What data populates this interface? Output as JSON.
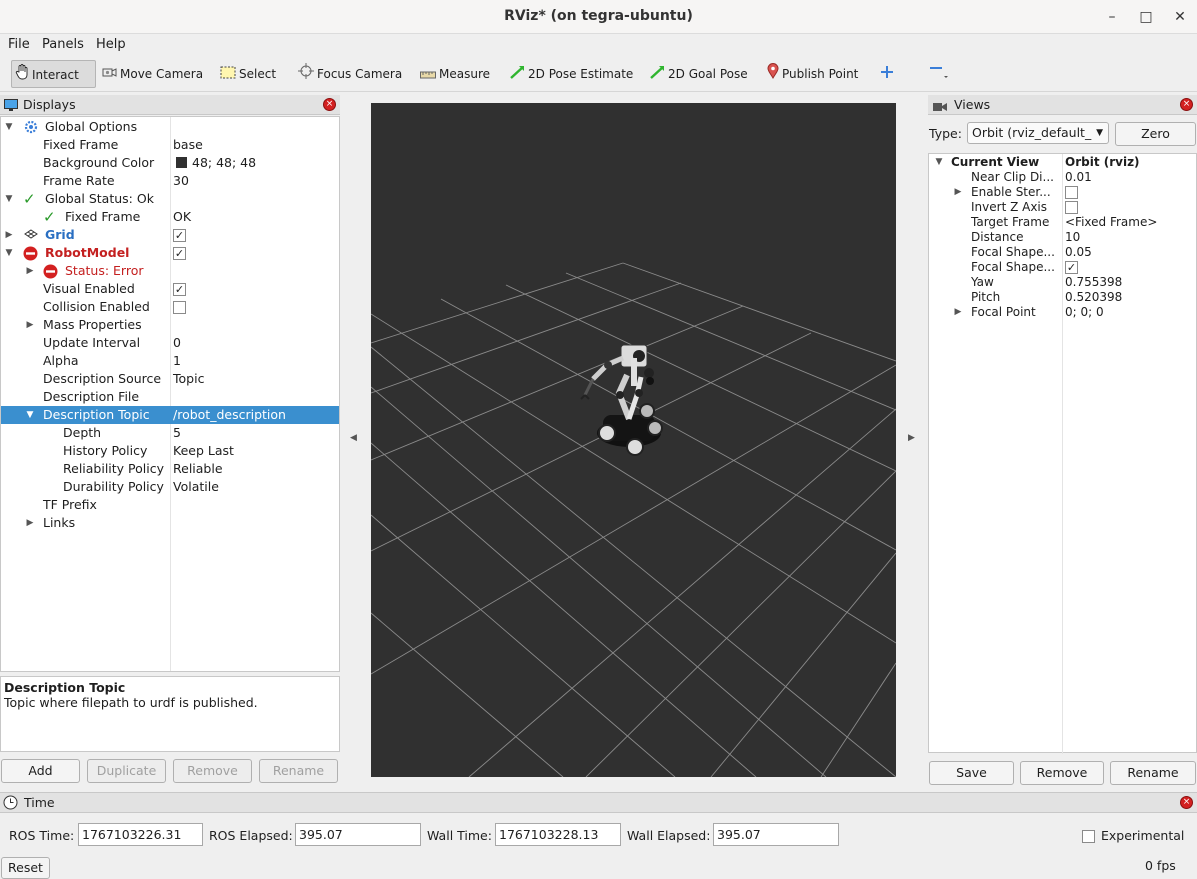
{
  "window": {
    "title": "RViz* (on tegra-ubuntu)",
    "minimize": "–",
    "maximize": "□",
    "close": "✕"
  },
  "menu": [
    "File",
    "Panels",
    "Help"
  ],
  "toolbar": {
    "interact": "Interact",
    "move_camera": "Move Camera",
    "select": "Select",
    "focus_camera": "Focus Camera",
    "measure": "Measure",
    "pose_estimate": "2D Pose Estimate",
    "goal_pose": "2D Goal Pose",
    "publish_point": "Publish Point"
  },
  "displays": {
    "title": "Displays",
    "rows": [
      {
        "label": "Global Options",
        "value": ""
      },
      {
        "label": "Fixed Frame",
        "value": "base"
      },
      {
        "label": "Background Color",
        "value": "48; 48; 48"
      },
      {
        "label": "Frame Rate",
        "value": "30"
      },
      {
        "label": "Global Status: Ok",
        "value": ""
      },
      {
        "label": "Fixed Frame",
        "value": "OK"
      },
      {
        "label": "Grid",
        "value": ""
      },
      {
        "label": "RobotModel",
        "value": ""
      },
      {
        "label": "Status: Error",
        "value": ""
      },
      {
        "label": "Visual Enabled",
        "value": ""
      },
      {
        "label": "Collision Enabled",
        "value": ""
      },
      {
        "label": "Mass Properties",
        "value": ""
      },
      {
        "label": "Update Interval",
        "value": "0"
      },
      {
        "label": "Alpha",
        "value": "1"
      },
      {
        "label": "Description Source",
        "value": "Topic"
      },
      {
        "label": "Description File",
        "value": ""
      },
      {
        "label": "Description Topic",
        "value": "/robot_description"
      },
      {
        "label": "Depth",
        "value": "5"
      },
      {
        "label": "History Policy",
        "value": "Keep Last"
      },
      {
        "label": "Reliability Policy",
        "value": "Reliable"
      },
      {
        "label": "Durability Policy",
        "value": "Volatile"
      },
      {
        "label": "TF Prefix",
        "value": ""
      },
      {
        "label": "Links",
        "value": ""
      }
    ],
    "description_title": "Description Topic",
    "description_text": "Topic where filepath to urdf is published.",
    "buttons": {
      "add": "Add",
      "duplicate": "Duplicate",
      "remove": "Remove",
      "rename": "Rename"
    },
    "background_color": "#303030"
  },
  "views": {
    "title": "Views",
    "type_label": "Type:",
    "type_value": "Orbit (rviz_default_",
    "zero": "Zero",
    "rows": [
      {
        "label": "Current View",
        "value": "Orbit (rviz)"
      },
      {
        "label": "Near Clip Di...",
        "value": "0.01"
      },
      {
        "label": "Enable Ster...",
        "value": ""
      },
      {
        "label": "Invert Z Axis",
        "value": ""
      },
      {
        "label": "Target Frame",
        "value": "<Fixed Frame>"
      },
      {
        "label": "Distance",
        "value": "10"
      },
      {
        "label": "Focal Shape...",
        "value": "0.05"
      },
      {
        "label": "Focal Shape...",
        "value": ""
      },
      {
        "label": "Yaw",
        "value": "0.755398"
      },
      {
        "label": "Pitch",
        "value": "0.520398"
      },
      {
        "label": "Focal Point",
        "value": "0; 0; 0"
      }
    ],
    "buttons": {
      "save": "Save",
      "remove": "Remove",
      "rename": "Rename"
    }
  },
  "time": {
    "title": "Time",
    "ros_time_label": "ROS Time:",
    "ros_time": "1767103226.31",
    "ros_elapsed_label": "ROS Elapsed:",
    "ros_elapsed": "395.07",
    "wall_time_label": "Wall Time:",
    "wall_time": "1767103228.13",
    "wall_elapsed_label": "Wall Elapsed:",
    "wall_elapsed": "395.07",
    "experimental": "Experimental",
    "reset": "Reset",
    "fps": "0 fps"
  }
}
